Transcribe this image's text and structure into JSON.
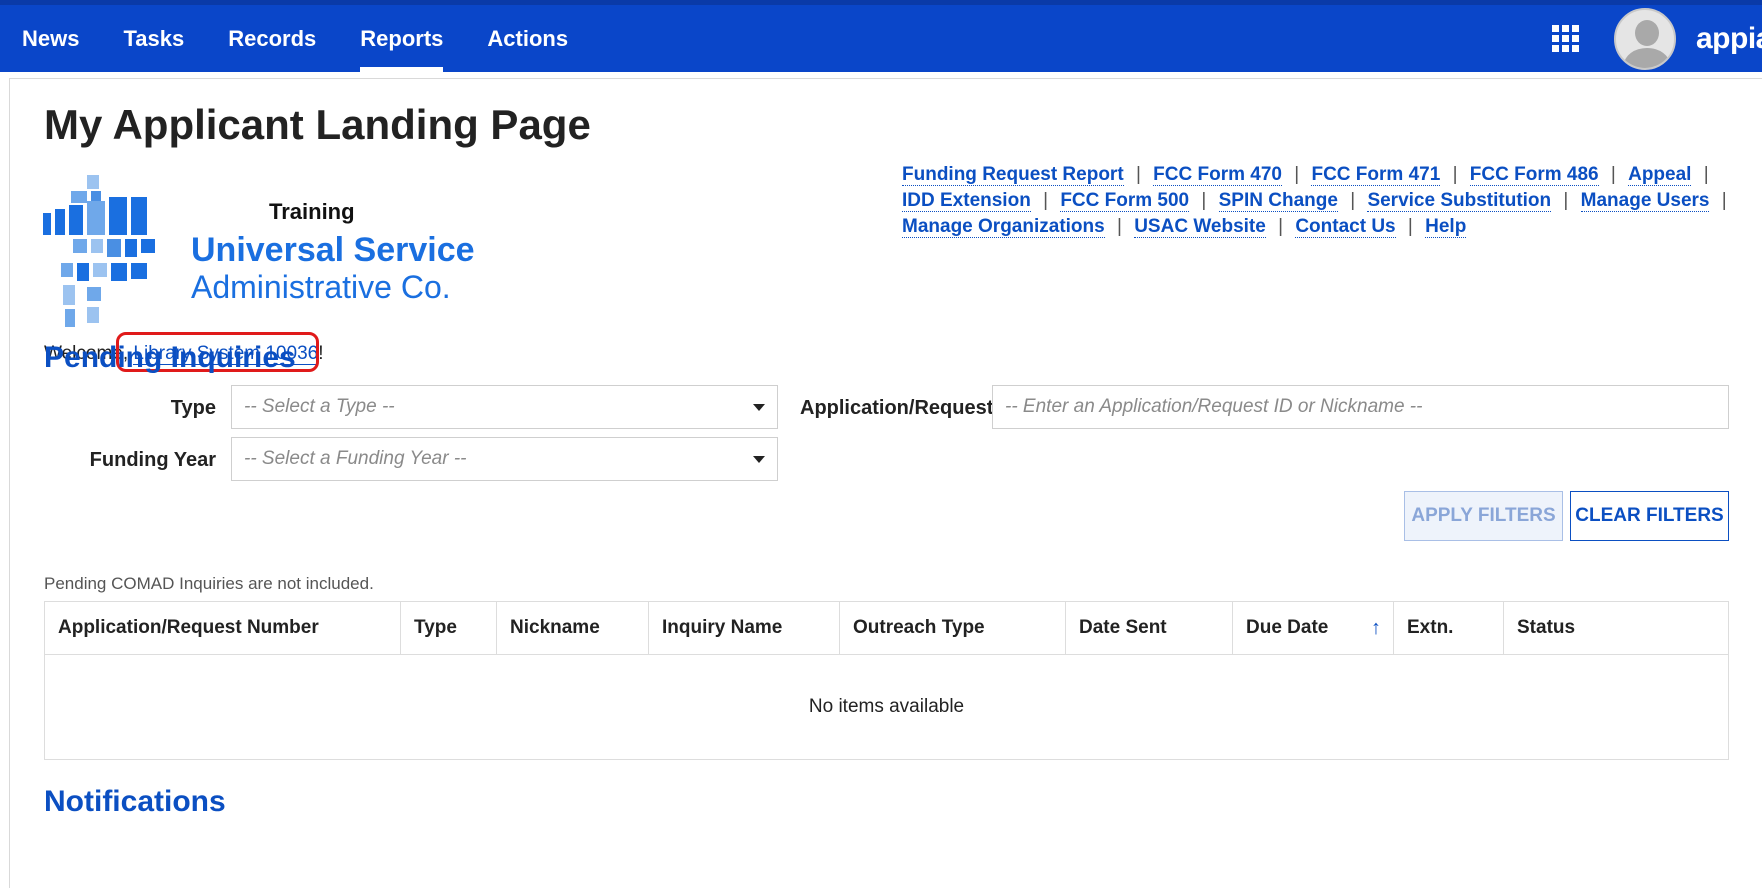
{
  "nav": {
    "items": [
      {
        "label": "News"
      },
      {
        "label": "Tasks"
      },
      {
        "label": "Records"
      },
      {
        "label": "Reports"
      },
      {
        "label": "Actions"
      }
    ],
    "active": "Reports",
    "brand": "appian"
  },
  "page": {
    "title": "My Applicant Landing Page"
  },
  "logo": {
    "badge": "Training",
    "line1": "Universal Service",
    "line2": "Administrative Co."
  },
  "quick_links": [
    "Funding Request Report",
    "FCC Form 470",
    "FCC Form 471",
    "FCC Form 486",
    "Appeal",
    "IDD Extension",
    "FCC Form 500",
    "SPIN Change",
    "Service Substitution",
    "Manage Users",
    "Manage Organizations",
    "USAC Website",
    "Contact Us",
    "Help"
  ],
  "quick_links_separator": "|",
  "welcome": {
    "prefix": "Welcome, ",
    "user": "Library System 10036",
    "suffix": "!"
  },
  "pending": {
    "heading": "Pending Inquiries",
    "type_label": "Type",
    "type_placeholder": "-- Select a Type --",
    "app_label": "Application/Request",
    "app_placeholder": "-- Enter an Application/Request ID or Nickname --",
    "year_label": "Funding Year",
    "year_placeholder": "-- Select a Funding Year --",
    "apply_label": "APPLY FILTERS",
    "clear_label": "CLEAR FILTERS",
    "note": "Pending COMAD Inquiries are not included.",
    "columns": [
      "Application/Request Number",
      "Type",
      "Nickname",
      "Inquiry Name",
      "Outreach Type",
      "Date Sent",
      "Due Date",
      "Extn.",
      "Status"
    ],
    "sort_icon": "↑",
    "empty_text": "No items available"
  },
  "notifications": {
    "heading": "Notifications"
  },
  "colors": {
    "topbar": "#0a46c9",
    "link": "#0b4fc2",
    "highlight": "#e01a1a"
  }
}
